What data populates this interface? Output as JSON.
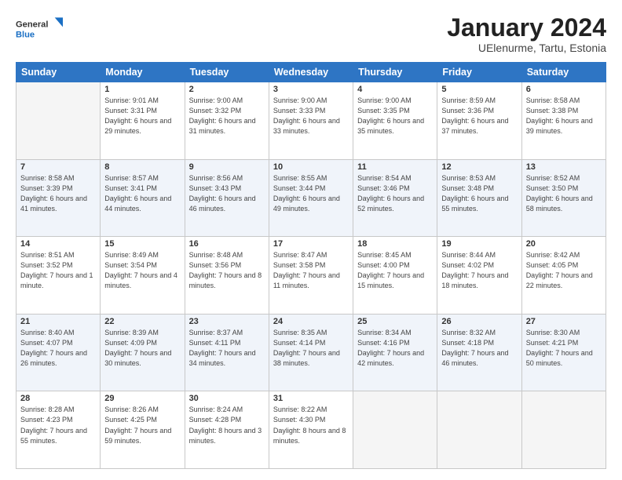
{
  "header": {
    "logo_general": "General",
    "logo_blue": "Blue",
    "month_year": "January 2024",
    "location": "UElenurme, Tartu, Estonia"
  },
  "weekdays": [
    "Sunday",
    "Monday",
    "Tuesday",
    "Wednesday",
    "Thursday",
    "Friday",
    "Saturday"
  ],
  "weeks": [
    [
      {
        "day": "",
        "sunrise": "",
        "sunset": "",
        "daylight": ""
      },
      {
        "day": "1",
        "sunrise": "Sunrise: 9:01 AM",
        "sunset": "Sunset: 3:31 PM",
        "daylight": "Daylight: 6 hours and 29 minutes."
      },
      {
        "day": "2",
        "sunrise": "Sunrise: 9:00 AM",
        "sunset": "Sunset: 3:32 PM",
        "daylight": "Daylight: 6 hours and 31 minutes."
      },
      {
        "day": "3",
        "sunrise": "Sunrise: 9:00 AM",
        "sunset": "Sunset: 3:33 PM",
        "daylight": "Daylight: 6 hours and 33 minutes."
      },
      {
        "day": "4",
        "sunrise": "Sunrise: 9:00 AM",
        "sunset": "Sunset: 3:35 PM",
        "daylight": "Daylight: 6 hours and 35 minutes."
      },
      {
        "day": "5",
        "sunrise": "Sunrise: 8:59 AM",
        "sunset": "Sunset: 3:36 PM",
        "daylight": "Daylight: 6 hours and 37 minutes."
      },
      {
        "day": "6",
        "sunrise": "Sunrise: 8:58 AM",
        "sunset": "Sunset: 3:38 PM",
        "daylight": "Daylight: 6 hours and 39 minutes."
      }
    ],
    [
      {
        "day": "7",
        "sunrise": "Sunrise: 8:58 AM",
        "sunset": "Sunset: 3:39 PM",
        "daylight": "Daylight: 6 hours and 41 minutes."
      },
      {
        "day": "8",
        "sunrise": "Sunrise: 8:57 AM",
        "sunset": "Sunset: 3:41 PM",
        "daylight": "Daylight: 6 hours and 44 minutes."
      },
      {
        "day": "9",
        "sunrise": "Sunrise: 8:56 AM",
        "sunset": "Sunset: 3:43 PM",
        "daylight": "Daylight: 6 hours and 46 minutes."
      },
      {
        "day": "10",
        "sunrise": "Sunrise: 8:55 AM",
        "sunset": "Sunset: 3:44 PM",
        "daylight": "Daylight: 6 hours and 49 minutes."
      },
      {
        "day": "11",
        "sunrise": "Sunrise: 8:54 AM",
        "sunset": "Sunset: 3:46 PM",
        "daylight": "Daylight: 6 hours and 52 minutes."
      },
      {
        "day": "12",
        "sunrise": "Sunrise: 8:53 AM",
        "sunset": "Sunset: 3:48 PM",
        "daylight": "Daylight: 6 hours and 55 minutes."
      },
      {
        "day": "13",
        "sunrise": "Sunrise: 8:52 AM",
        "sunset": "Sunset: 3:50 PM",
        "daylight": "Daylight: 6 hours and 58 minutes."
      }
    ],
    [
      {
        "day": "14",
        "sunrise": "Sunrise: 8:51 AM",
        "sunset": "Sunset: 3:52 PM",
        "daylight": "Daylight: 7 hours and 1 minute."
      },
      {
        "day": "15",
        "sunrise": "Sunrise: 8:49 AM",
        "sunset": "Sunset: 3:54 PM",
        "daylight": "Daylight: 7 hours and 4 minutes."
      },
      {
        "day": "16",
        "sunrise": "Sunrise: 8:48 AM",
        "sunset": "Sunset: 3:56 PM",
        "daylight": "Daylight: 7 hours and 8 minutes."
      },
      {
        "day": "17",
        "sunrise": "Sunrise: 8:47 AM",
        "sunset": "Sunset: 3:58 PM",
        "daylight": "Daylight: 7 hours and 11 minutes."
      },
      {
        "day": "18",
        "sunrise": "Sunrise: 8:45 AM",
        "sunset": "Sunset: 4:00 PM",
        "daylight": "Daylight: 7 hours and 15 minutes."
      },
      {
        "day": "19",
        "sunrise": "Sunrise: 8:44 AM",
        "sunset": "Sunset: 4:02 PM",
        "daylight": "Daylight: 7 hours and 18 minutes."
      },
      {
        "day": "20",
        "sunrise": "Sunrise: 8:42 AM",
        "sunset": "Sunset: 4:05 PM",
        "daylight": "Daylight: 7 hours and 22 minutes."
      }
    ],
    [
      {
        "day": "21",
        "sunrise": "Sunrise: 8:40 AM",
        "sunset": "Sunset: 4:07 PM",
        "daylight": "Daylight: 7 hours and 26 minutes."
      },
      {
        "day": "22",
        "sunrise": "Sunrise: 8:39 AM",
        "sunset": "Sunset: 4:09 PM",
        "daylight": "Daylight: 7 hours and 30 minutes."
      },
      {
        "day": "23",
        "sunrise": "Sunrise: 8:37 AM",
        "sunset": "Sunset: 4:11 PM",
        "daylight": "Daylight: 7 hours and 34 minutes."
      },
      {
        "day": "24",
        "sunrise": "Sunrise: 8:35 AM",
        "sunset": "Sunset: 4:14 PM",
        "daylight": "Daylight: 7 hours and 38 minutes."
      },
      {
        "day": "25",
        "sunrise": "Sunrise: 8:34 AM",
        "sunset": "Sunset: 4:16 PM",
        "daylight": "Daylight: 7 hours and 42 minutes."
      },
      {
        "day": "26",
        "sunrise": "Sunrise: 8:32 AM",
        "sunset": "Sunset: 4:18 PM",
        "daylight": "Daylight: 7 hours and 46 minutes."
      },
      {
        "day": "27",
        "sunrise": "Sunrise: 8:30 AM",
        "sunset": "Sunset: 4:21 PM",
        "daylight": "Daylight: 7 hours and 50 minutes."
      }
    ],
    [
      {
        "day": "28",
        "sunrise": "Sunrise: 8:28 AM",
        "sunset": "Sunset: 4:23 PM",
        "daylight": "Daylight: 7 hours and 55 minutes."
      },
      {
        "day": "29",
        "sunrise": "Sunrise: 8:26 AM",
        "sunset": "Sunset: 4:25 PM",
        "daylight": "Daylight: 7 hours and 59 minutes."
      },
      {
        "day": "30",
        "sunrise": "Sunrise: 8:24 AM",
        "sunset": "Sunset: 4:28 PM",
        "daylight": "Daylight: 8 hours and 3 minutes."
      },
      {
        "day": "31",
        "sunrise": "Sunrise: 8:22 AM",
        "sunset": "Sunset: 4:30 PM",
        "daylight": "Daylight: 8 hours and 8 minutes."
      },
      {
        "day": "",
        "sunrise": "",
        "sunset": "",
        "daylight": ""
      },
      {
        "day": "",
        "sunrise": "",
        "sunset": "",
        "daylight": ""
      },
      {
        "day": "",
        "sunrise": "",
        "sunset": "",
        "daylight": ""
      }
    ]
  ]
}
